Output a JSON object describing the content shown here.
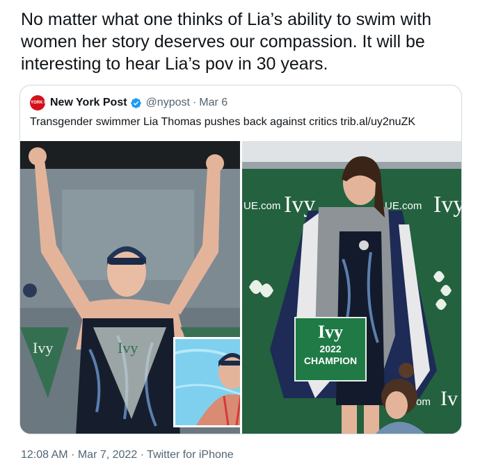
{
  "tweet": {
    "text": "No matter what one thinks of Lia’s ability to swim with women her story deserves our compassion. It will be interesting to hear Lia’s pov in 30 years."
  },
  "quoted_tweet": {
    "avatar_text": "NEW YORK POST",
    "author_name": "New York Post",
    "verified": true,
    "handle": "@nypost",
    "separator": "·",
    "date": "Mar 6",
    "text": "Transgender swimmer Lia Thomas pushes back against critics trib.al/uy2nuZK",
    "media": {
      "left_banner_text": "Ivy",
      "right_banner_text_1": "UE.com",
      "right_banner_logo": "Ivy",
      "right_banner_text_2": "UE.com",
      "right_banner_logo_2": "Ivy",
      "right_bottom_text": "om",
      "right_bottom_logo": "Iv",
      "sign_logo": "Ivy",
      "sign_year": "2022",
      "sign_label": "CHAMPION"
    }
  },
  "meta": {
    "time": "12:08 AM",
    "separator": "·",
    "date": "Mar 7, 2022",
    "source": "Twitter for iPhone"
  },
  "colors": {
    "verified_blue": "#1d9bf0",
    "post_red": "#d6101a",
    "ivy_green": "#1f7a45"
  }
}
